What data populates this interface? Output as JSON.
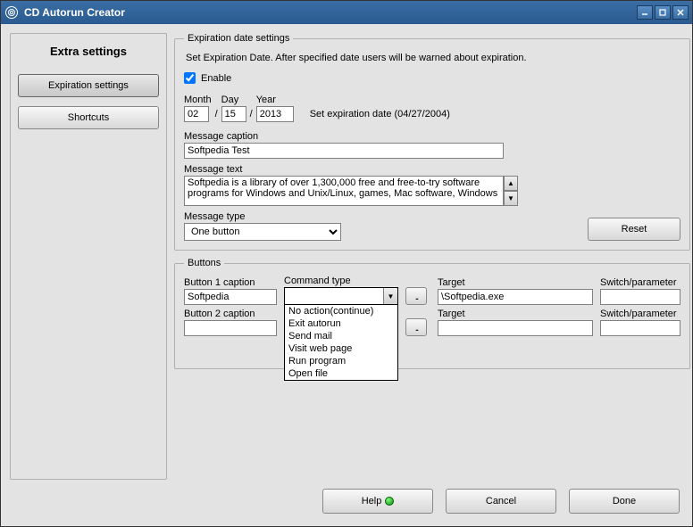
{
  "window": {
    "title": "CD Autorun Creator"
  },
  "sidebar": {
    "title": "Extra settings",
    "expiration_btn": "Expiration settings",
    "shortcuts_btn": "Shortcuts"
  },
  "expiration": {
    "legend": "Expiration date settings",
    "hint": "Set  Expiration Date. After specified date users will be warned about expiration.",
    "enable_label": "Enable",
    "month_label": "Month",
    "day_label": "Day",
    "year_label": "Year",
    "month": "02",
    "day": "15",
    "year": "2013",
    "date_hint": "Set expiration date (04/27/2004)",
    "msg_caption_label": "Message caption",
    "msg_caption": "Softpedia Test",
    "msg_text_label": "Message text",
    "msg_text": "Softpedia is a library of over 1,300,000 free and free-to-try software programs for Windows and Unix/Linux, games, Mac software, Windows",
    "msg_type_label": "Message type",
    "msg_type": "One button",
    "reset_btn": "Reset"
  },
  "buttons": {
    "legend": "Buttons",
    "b1_caption_label": "Button 1 caption",
    "b1_caption": "Softpedia",
    "command_type_label": "Command type",
    "target1_label": "Target",
    "target1": "\\Softpedia.exe",
    "switch1_label": "Switch/parameter",
    "switch1": "",
    "b2_caption_label": "Button 2 caption",
    "b2_caption": "",
    "target2_label": "Target",
    "target2": "",
    "switch2_label": "Switch/parameter",
    "switch2": "",
    "browse": "..",
    "dropdown": {
      "opt0": "No action(continue)",
      "opt1": "Exit autorun",
      "opt2": "Send mail",
      "opt3": "Visit web page",
      "opt4": "Run program",
      "opt5": "Open file"
    }
  },
  "footer": {
    "help": "Help",
    "cancel": "Cancel",
    "done": "Done"
  }
}
